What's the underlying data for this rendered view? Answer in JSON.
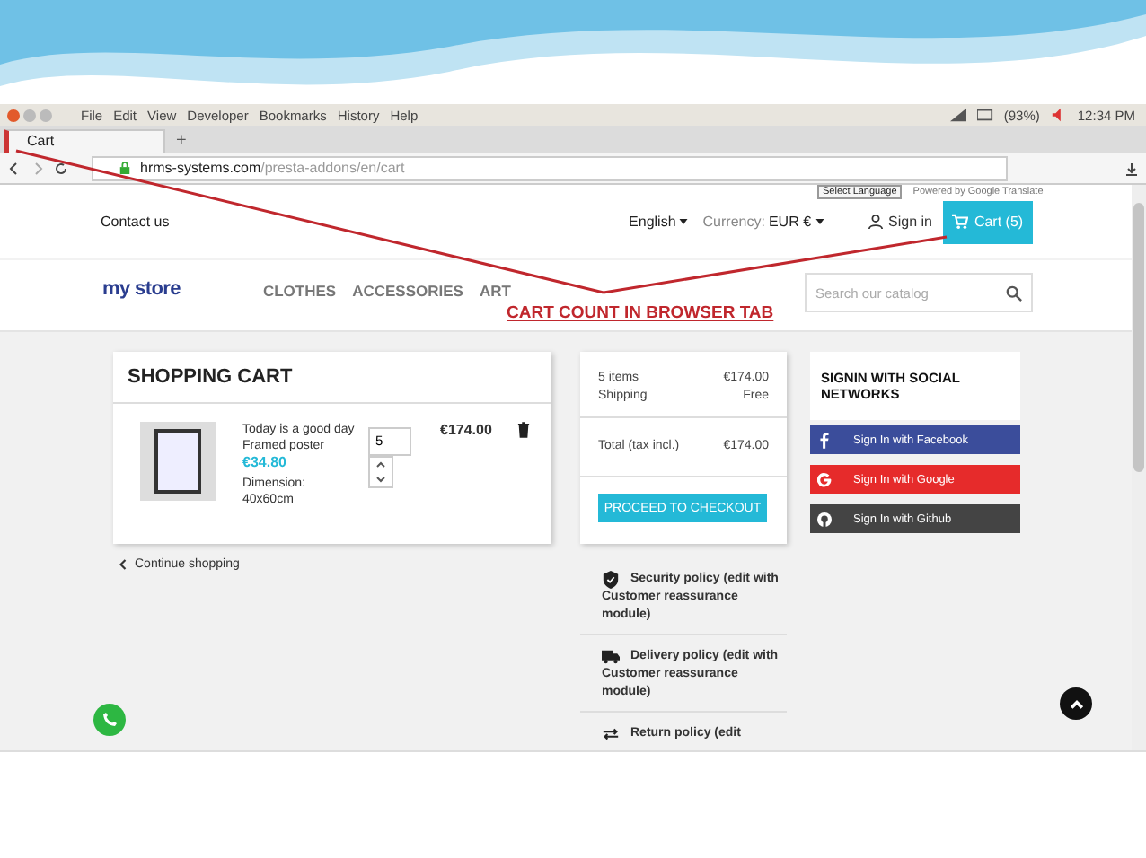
{
  "browser": {
    "menu": [
      "File",
      "Edit",
      "View",
      "Developer",
      "Bookmarks",
      "History",
      "Help"
    ],
    "battery": "(93%)",
    "time": "12:34 PM",
    "tab": {
      "title": "Cart",
      "selected": true
    },
    "new_tab": "+",
    "url": {
      "domain": "hrms-systems.com",
      "path": "/presta-addons/en/cart"
    }
  },
  "translate": {
    "select": "Select Language",
    "powered": "Powered by Google Translate"
  },
  "header": {
    "contact": "Contact us",
    "language": "English",
    "currency_label": "Currency:",
    "currency": "EUR €",
    "sign_in": "Sign in",
    "cart": "Cart (5)"
  },
  "logo": "my store",
  "nav": [
    "CLOTHES",
    "ACCESSORIES",
    "ART"
  ],
  "search": {
    "placeholder": "Search our catalog"
  },
  "annotation": "CART COUNT IN BROWSER TAB",
  "cart": {
    "title": "SHOPPING CART",
    "items": [
      {
        "name": "Today is a good day",
        "variant": "Framed poster",
        "price": "€34.80",
        "attr_label": "Dimension:",
        "attr_value": "40x60cm",
        "quantity": "5",
        "total": "€174.00"
      }
    ],
    "continue": "Continue shopping"
  },
  "summary": {
    "lines": [
      {
        "label": "5 items",
        "value": "€174.00"
      },
      {
        "label": "Shipping",
        "value": "Free"
      }
    ],
    "total": {
      "label": "Total (tax incl.)",
      "value": "€174.00"
    },
    "checkout": "PROCEED TO CHECKOUT"
  },
  "social": {
    "title": "SIGNIN WITH SOCIAL NETWORKS",
    "buttons": [
      {
        "kind": "facebook",
        "label": "Sign In with Facebook"
      },
      {
        "kind": "google",
        "label": "Sign In with Google"
      },
      {
        "kind": "github",
        "label": "Sign In with Github"
      }
    ]
  },
  "reassurance": [
    {
      "kind": "security",
      "text": "Security policy (edit with Customer reassurance module)"
    },
    {
      "kind": "delivery",
      "text": "Delivery policy (edit with Customer reassurance module)"
    },
    {
      "kind": "return",
      "text": "Return policy (edit"
    }
  ]
}
